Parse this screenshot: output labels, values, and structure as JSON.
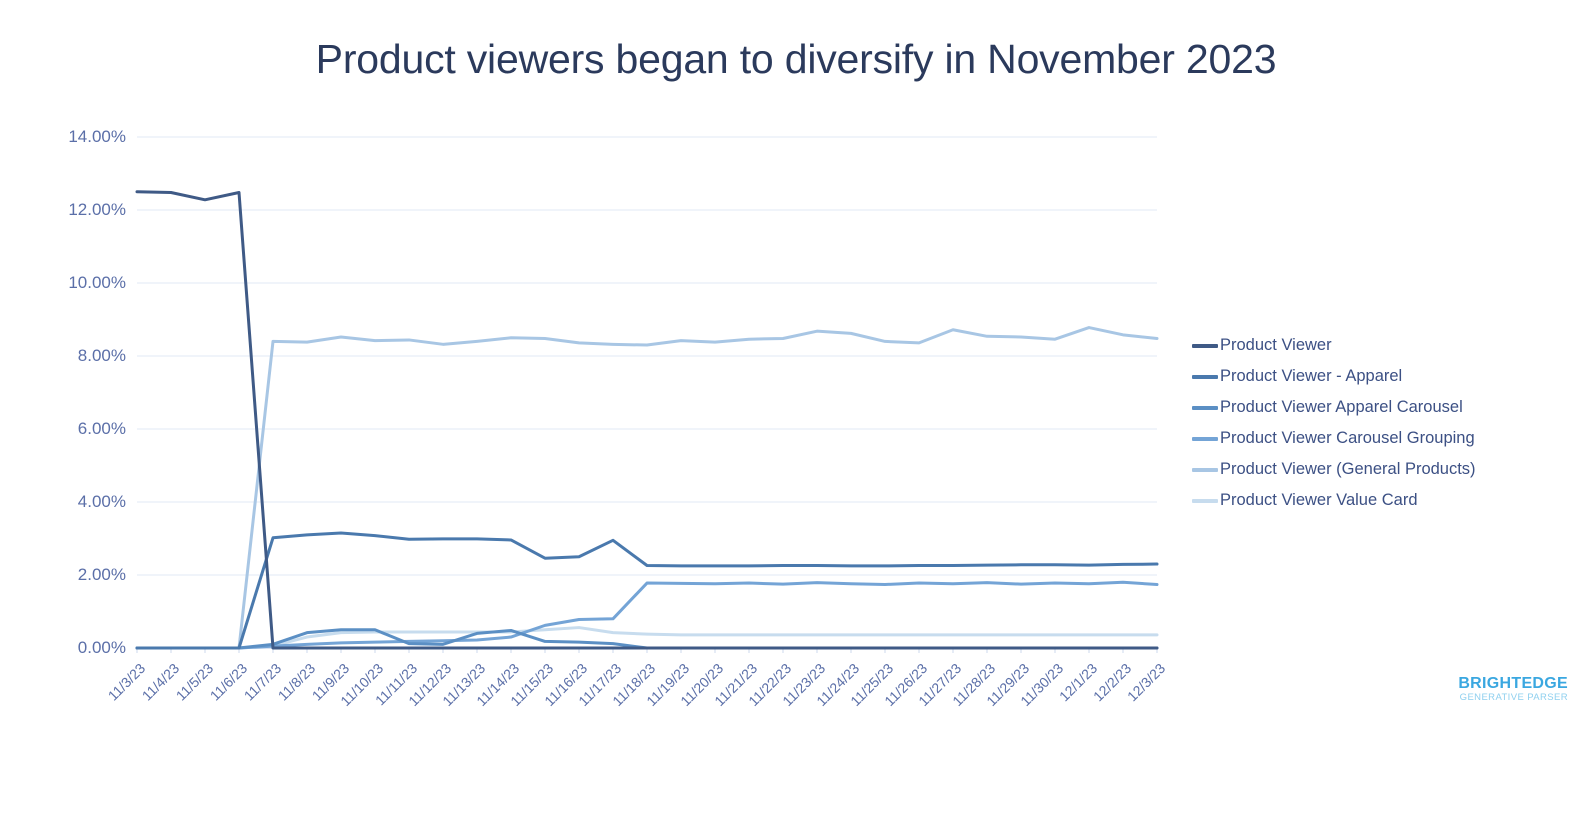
{
  "chart_data": {
    "type": "line",
    "title": "Product viewers began to diversify in November 2023",
    "xlabel": "",
    "ylabel": "",
    "ylim": [
      0,
      14
    ],
    "ytick_labels": [
      "0.00%",
      "2.00%",
      "4.00%",
      "6.00%",
      "8.00%",
      "10.00%",
      "12.00%",
      "14.00%"
    ],
    "ytick_values": [
      0,
      2,
      4,
      6,
      8,
      10,
      12,
      14
    ],
    "grid": true,
    "legend_position": "right",
    "y_unit": "%",
    "categories": [
      "11/3/23",
      "11/4/23",
      "11/5/23",
      "11/6/23",
      "11/7/23",
      "11/8/23",
      "11/9/23",
      "11/10/23",
      "11/11/23",
      "11/12/23",
      "11/13/23",
      "11/14/23",
      "11/15/23",
      "11/16/23",
      "11/17/23",
      "11/18/23",
      "11/19/23",
      "11/20/23",
      "11/21/23",
      "11/22/23",
      "11/23/23",
      "11/24/23",
      "11/25/23",
      "11/26/23",
      "11/27/23",
      "11/28/23",
      "11/29/23",
      "11/30/23",
      "12/1/23",
      "12/2/23",
      "12/3/23"
    ],
    "series": [
      {
        "name": "Product Viewer",
        "color": "#3f5a86",
        "values": [
          12.5,
          12.48,
          12.28,
          12.48,
          0.0,
          0.0,
          0.0,
          0.0,
          0.0,
          0.0,
          0.0,
          0.0,
          0.0,
          0.0,
          0.0,
          0.0,
          0.0,
          0.0,
          0.0,
          0.0,
          0.0,
          0.0,
          0.0,
          0.0,
          0.0,
          0.0,
          0.0,
          0.0,
          0.0,
          0.0,
          0.0
        ]
      },
      {
        "name": "Product Viewer - Apparel",
        "color": "#4a79ad",
        "values": [
          0.0,
          0.0,
          0.0,
          0.0,
          3.02,
          3.1,
          3.15,
          3.08,
          2.98,
          2.99,
          2.99,
          2.96,
          2.46,
          2.5,
          2.95,
          2.26,
          2.25,
          2.25,
          2.25,
          2.26,
          2.26,
          2.25,
          2.25,
          2.26,
          2.26,
          2.27,
          2.28,
          2.28,
          2.27,
          2.29,
          2.3
        ]
      },
      {
        "name": "Product Viewer Apparel Carousel",
        "color": "#5b8fc4",
        "values": [
          0.0,
          0.0,
          0.0,
          0.0,
          0.1,
          0.42,
          0.5,
          0.5,
          0.12,
          0.1,
          0.4,
          0.48,
          0.18,
          0.16,
          0.12,
          0.0,
          0.0,
          0.0,
          0.0,
          0.0,
          0.0,
          0.0,
          0.0,
          0.0,
          0.0,
          0.0,
          0.0,
          0.0,
          0.0,
          0.0,
          0.0
        ]
      },
      {
        "name": "Product Viewer Carousel Grouping",
        "color": "#74a4d6",
        "values": [
          0.0,
          0.0,
          0.0,
          0.0,
          0.05,
          0.1,
          0.14,
          0.16,
          0.18,
          0.2,
          0.22,
          0.3,
          0.62,
          0.78,
          0.8,
          1.78,
          1.77,
          1.76,
          1.78,
          1.75,
          1.79,
          1.76,
          1.74,
          1.78,
          1.76,
          1.79,
          1.75,
          1.78,
          1.76,
          1.8,
          1.74
        ]
      },
      {
        "name": "Product Viewer (General Products)",
        "color": "#a8c6e4",
        "values": [
          0.0,
          0.0,
          0.0,
          0.0,
          8.4,
          8.38,
          8.52,
          8.42,
          8.44,
          8.32,
          8.4,
          8.5,
          8.48,
          8.36,
          8.32,
          8.3,
          8.42,
          8.38,
          8.46,
          8.48,
          8.68,
          8.62,
          8.4,
          8.36,
          8.72,
          8.54,
          8.52,
          8.46,
          8.78,
          8.58,
          8.48
        ]
      },
      {
        "name": "Product Viewer Value Card",
        "color": "#c7dcee",
        "values": [
          0.0,
          0.0,
          0.0,
          0.0,
          0.06,
          0.3,
          0.42,
          0.44,
          0.44,
          0.44,
          0.44,
          0.44,
          0.5,
          0.56,
          0.42,
          0.38,
          0.36,
          0.36,
          0.36,
          0.36,
          0.36,
          0.36,
          0.36,
          0.36,
          0.36,
          0.36,
          0.36,
          0.36,
          0.36,
          0.36,
          0.36
        ]
      }
    ]
  },
  "legend": {
    "items": [
      {
        "label": "Product Viewer",
        "color": "#3f5a86"
      },
      {
        "label": "Product Viewer - Apparel",
        "color": "#4a79ad"
      },
      {
        "label": "Product Viewer Apparel Carousel",
        "color": "#5b8fc4"
      },
      {
        "label": "Product Viewer Carousel Grouping",
        "color": "#74a4d6"
      },
      {
        "label": "Product Viewer (General Products)",
        "color": "#a8c6e4"
      },
      {
        "label": "Product Viewer Value Card",
        "color": "#c7dcee"
      }
    ]
  },
  "logo": {
    "main": "BRIGHTEDGE",
    "sub": "GENERATIVE PARSER"
  },
  "theme": {
    "title_color": "#2b3a5c",
    "tick_color": "#5b6fa8",
    "grid_color": "#e8eef8",
    "axis_color": "#d4dff0",
    "background": "#ffffff"
  }
}
